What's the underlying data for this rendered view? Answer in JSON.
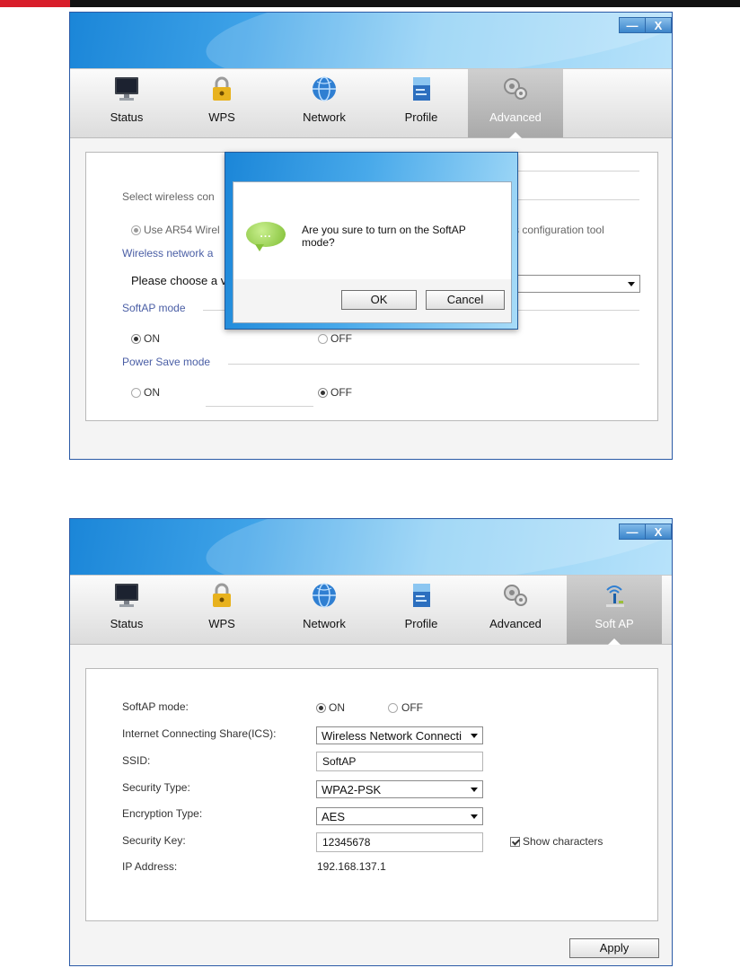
{
  "top_screenshot": {
    "tabs": [
      {
        "label": "Status",
        "icon": "monitor-icon"
      },
      {
        "label": "WPS",
        "icon": "lock-icon"
      },
      {
        "label": "Network",
        "icon": "globe-icon"
      },
      {
        "label": "Profile",
        "icon": "profile-icon"
      },
      {
        "label": "Advanced",
        "icon": "gears-icon",
        "active": true
      }
    ],
    "content": {
      "select_wireless_label": "Select wireless con",
      "use_ar54_label": "Use AR54 Wirel",
      "config_tool_tail": "s configuration tool",
      "wireless_network_label": "Wireless network a",
      "please_choose_label": "Please choose a v",
      "softap_mode_label": "SoftAP mode",
      "softap_on": "ON",
      "softap_off": "OFF",
      "power_save_label": "Power Save mode",
      "power_on": "ON",
      "power_off": "OFF"
    },
    "dialog": {
      "bubble_icon": "speech-bubble-icon",
      "bubble_text": "...",
      "message": "Are you sure to turn on the SoftAP mode?",
      "ok_label": "OK",
      "cancel_label": "Cancel"
    }
  },
  "bottom_screenshot": {
    "tabs": [
      {
        "label": "Status",
        "icon": "monitor-icon"
      },
      {
        "label": "WPS",
        "icon": "lock-icon"
      },
      {
        "label": "Network",
        "icon": "globe-icon"
      },
      {
        "label": "Profile",
        "icon": "profile-icon"
      },
      {
        "label": "Advanced",
        "icon": "gears-icon"
      },
      {
        "label": "Soft AP",
        "icon": "antenna-icon",
        "active": true
      }
    ],
    "form": {
      "softap_mode_label": "SoftAP mode:",
      "softap_on": "ON",
      "softap_off": "OFF",
      "ics_label": "Internet Connecting Share(ICS):",
      "ics_value": "Wireless Network Connecti",
      "ssid_label": "SSID:",
      "ssid_value": "SoftAP",
      "security_type_label": "Security Type:",
      "security_type_value": "WPA2-PSK",
      "encryption_type_label": "Encryption Type:",
      "encryption_type_value": "AES",
      "security_key_label": "Security Key:",
      "security_key_value": "12345678",
      "show_characters_label": "Show characters",
      "ip_address_label": "IP Address:",
      "ip_address_value": "192.168.137.1"
    },
    "apply_label": "Apply"
  },
  "window_buttons": {
    "minimize": "—",
    "close": "X"
  }
}
